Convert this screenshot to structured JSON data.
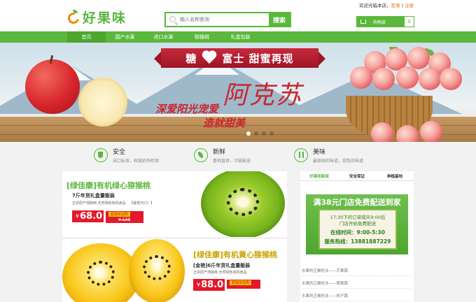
{
  "header": {
    "logo_text": "好果味",
    "search_placeholder": "输入名称查询",
    "search_button": "搜索",
    "welcome_text": "欢迎光临本店，",
    "login_link": "登录",
    "separator": "|",
    "register_link": "注册",
    "cart_label": "购物袋",
    "cart_count": "0"
  },
  "nav": {
    "items": [
      {
        "label": "首页"
      },
      {
        "label": "国产水果"
      },
      {
        "label": "进口水果"
      },
      {
        "label": "猕猴桃"
      },
      {
        "label": "礼盒包装"
      }
    ]
  },
  "banner": {
    "title_left": "糖",
    "title_right": "富士 甜蜜再现",
    "slogan": "阿克苏",
    "line1": "深爱阳光宠爱",
    "line2": "造就甜美",
    "slide_count": 4,
    "active_slide": 1
  },
  "features": [
    {
      "title": "安全",
      "desc": "出口标准，权威机构检测",
      "icon": "shield-icon"
    },
    {
      "title": "新鲜",
      "desc": "基地直供，冷链配送",
      "icon": "leaf-icon"
    },
    {
      "title": "美味",
      "desc": "最原始的味道，绿色的味道",
      "icon": "fork-knife-icon"
    }
  ],
  "products": [
    {
      "title": "[绿佳康]有机绿心猕猴桃",
      "spec": "7斤年货礼盒量贩装",
      "desc": "正宗原产地陕西 天然绿色有机食品",
      "tag": "【最低可口！】",
      "currency": "¥",
      "price": "68.0",
      "ribbon": "超值买狂购",
      "old_price": "¥ 138"
    },
    {
      "title": "[绿佳康]有机黄心猕猴桃",
      "spec_prefix": "[金艳]",
      "spec": "6斤年货礼盒量贩装",
      "desc": "正宗原产地陕西 天然绿色有机食品",
      "currency": "¥",
      "price": "88.0",
      "ribbon": "超值买狂购"
    }
  ],
  "sidebar": {
    "tabs": [
      {
        "label": "好果味新闻"
      },
      {
        "label": "安全保证"
      },
      {
        "label": "种植基地"
      }
    ],
    "promo": {
      "headline": "满38元门店免费配送到家",
      "line1": "17:30下的订单隔天9:00后",
      "line2": "门店开始免费配送",
      "line3": "在线时间：9:00-5:30",
      "line4": "服务热线：13881887229"
    },
    "news": [
      {
        "label": "水果的正确吃法——芒果篇"
      },
      {
        "label": "水果的正确吃法——葡萄篇"
      },
      {
        "label": "水果的正确吃法——桃子篇"
      }
    ]
  },
  "colors": {
    "brand_green": "#5bb83b",
    "price_red": "#e3192c",
    "accent_orange": "#e2771f"
  }
}
